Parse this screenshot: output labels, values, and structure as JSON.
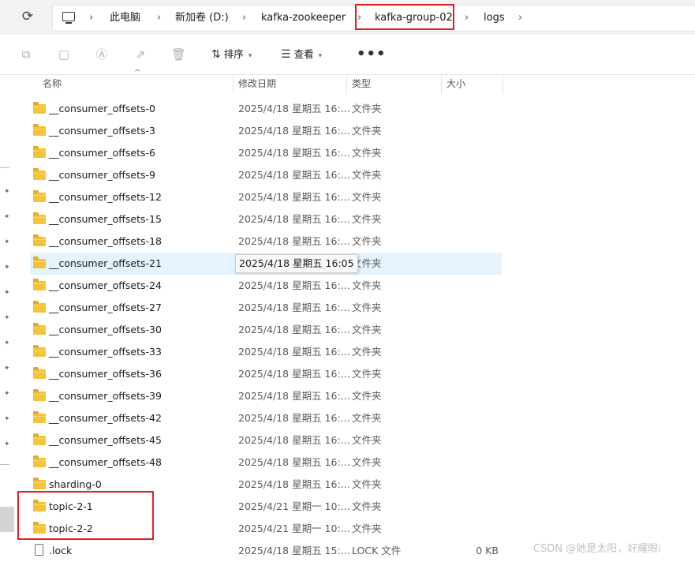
{
  "address": {
    "crumbs": [
      "此电脑",
      "新加卷 (D:)",
      "kafka-zookeeper",
      "kafka-group-02",
      "logs"
    ],
    "separator": "›"
  },
  "toolbar": {
    "sort_label": "排序",
    "view_label": "查看",
    "more_label": "•••",
    "disabled_icons": [
      "copy-icon",
      "paste-icon",
      "rename-icon",
      "share-icon",
      "delete-icon"
    ]
  },
  "columns": {
    "name": "名称",
    "date": "修改日期",
    "type": "类型",
    "size": "大小"
  },
  "files": [
    {
      "name": "__consumer_offsets-0",
      "date": "2025/4/18 星期五 16:...",
      "type": "文件夹",
      "size": "",
      "kind": "folder"
    },
    {
      "name": "__consumer_offsets-3",
      "date": "2025/4/18 星期五 16:...",
      "type": "文件夹",
      "size": "",
      "kind": "folder"
    },
    {
      "name": "__consumer_offsets-6",
      "date": "2025/4/18 星期五 16:...",
      "type": "文件夹",
      "size": "",
      "kind": "folder"
    },
    {
      "name": "__consumer_offsets-9",
      "date": "2025/4/18 星期五 16:...",
      "type": "文件夹",
      "size": "",
      "kind": "folder"
    },
    {
      "name": "__consumer_offsets-12",
      "date": "2025/4/18 星期五 16:...",
      "type": "文件夹",
      "size": "",
      "kind": "folder"
    },
    {
      "name": "__consumer_offsets-15",
      "date": "2025/4/18 星期五 16:...",
      "type": "文件夹",
      "size": "",
      "kind": "folder"
    },
    {
      "name": "__consumer_offsets-18",
      "date": "2025/4/18 星期五 16:...",
      "type": "文件夹",
      "size": "",
      "kind": "folder"
    },
    {
      "name": "__consumer_offsets-21",
      "date": "",
      "type": "文件夹",
      "size": "",
      "kind": "folder",
      "selected": true
    },
    {
      "name": "__consumer_offsets-24",
      "date": "2025/4/18 星期五 16:...",
      "type": "文件夹",
      "size": "",
      "kind": "folder"
    },
    {
      "name": "__consumer_offsets-27",
      "date": "2025/4/18 星期五 16:...",
      "type": "文件夹",
      "size": "",
      "kind": "folder"
    },
    {
      "name": "__consumer_offsets-30",
      "date": "2025/4/18 星期五 16:...",
      "type": "文件夹",
      "size": "",
      "kind": "folder"
    },
    {
      "name": "__consumer_offsets-33",
      "date": "2025/4/18 星期五 16:...",
      "type": "文件夹",
      "size": "",
      "kind": "folder"
    },
    {
      "name": "__consumer_offsets-36",
      "date": "2025/4/18 星期五 16:...",
      "type": "文件夹",
      "size": "",
      "kind": "folder"
    },
    {
      "name": "__consumer_offsets-39",
      "date": "2025/4/18 星期五 16:...",
      "type": "文件夹",
      "size": "",
      "kind": "folder"
    },
    {
      "name": "__consumer_offsets-42",
      "date": "2025/4/18 星期五 16:...",
      "type": "文件夹",
      "size": "",
      "kind": "folder"
    },
    {
      "name": "__consumer_offsets-45",
      "date": "2025/4/18 星期五 16:...",
      "type": "文件夹",
      "size": "",
      "kind": "folder"
    },
    {
      "name": "__consumer_offsets-48",
      "date": "2025/4/18 星期五 16:...",
      "type": "文件夹",
      "size": "",
      "kind": "folder"
    },
    {
      "name": "sharding-0",
      "date": "2025/4/18 星期五 16:...",
      "type": "文件夹",
      "size": "",
      "kind": "folder"
    },
    {
      "name": "topic-2-1",
      "date": "2025/4/21 星期一 10:...",
      "type": "文件夹",
      "size": "",
      "kind": "folder"
    },
    {
      "name": "topic-2-2",
      "date": "2025/4/21 星期一 10:...",
      "type": "文件夹",
      "size": "",
      "kind": "folder"
    },
    {
      "name": ".lock",
      "date": "2025/4/18 星期五 15:...",
      "type": "LOCK 文件",
      "size": "0 KB",
      "kind": "file"
    }
  ],
  "tooltip": {
    "text": "2025/4/18 星期五 16:05"
  },
  "watermark": "CSDN @她是太阳，好耀眼i",
  "colors": {
    "highlight_red": "#e02020",
    "selection": "#e5f3ff",
    "folder": "#f5c33b"
  }
}
